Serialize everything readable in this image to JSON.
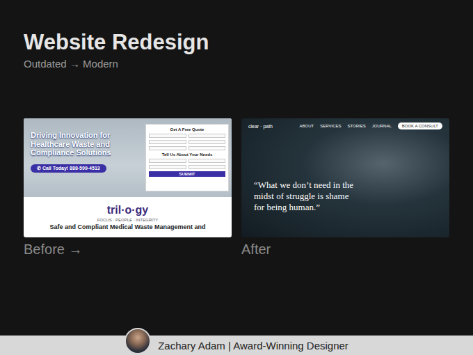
{
  "header": {
    "title": "Website Redesign",
    "subtitle": "Outdated → Modern"
  },
  "showcase": [
    {
      "label": "Before →",
      "kind": "before"
    },
    {
      "label": "After",
      "kind": "after"
    }
  ],
  "before_site": {
    "headline": "Driving Innovation for Healthcare Waste and Compliance Solutions",
    "cta": "✆ Call Today! 888-599-4513",
    "form": {
      "title": "Get A Free Quote",
      "section": "Tell Us About Your Needs",
      "submit": "SUBMIT"
    },
    "logo": "tril·o·gy",
    "tagline": "FOCUS · PEOPLE · INTEGRITY",
    "heading": "Safe and Compliant Medical Waste Management and"
  },
  "after_site": {
    "logo": "clear · path",
    "nav": [
      "ABOUT",
      "SERVICES",
      "STORIES",
      "JOURNAL"
    ],
    "cta": "BOOK A CONSULT",
    "quote": "“What we don’t need in the midst of struggle is shame for being human.”"
  },
  "footer": {
    "name": "Zachary Adam | Award-Winning Designer"
  }
}
